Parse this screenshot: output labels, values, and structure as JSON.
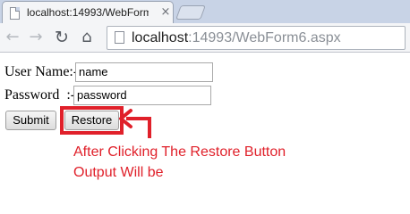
{
  "browser": {
    "tab_title": "localhost:14993/WebForm",
    "tab_close_glyph": "×",
    "icons": {
      "back": "←",
      "forward": "→",
      "reload": "↻",
      "home": "⌂"
    },
    "url": {
      "host": "localhost",
      "rest": ":14993/WebForm6.aspx"
    }
  },
  "form": {
    "username_label": "User Name:-",
    "username_value": "name",
    "password_label": "Password  :-",
    "password_value": "password",
    "submit_label": "Submit",
    "restore_label": "Restore"
  },
  "annotation": {
    "line1": "After Clicking The Restore Button",
    "line2": "Output Will be",
    "color": "#e0202a"
  }
}
